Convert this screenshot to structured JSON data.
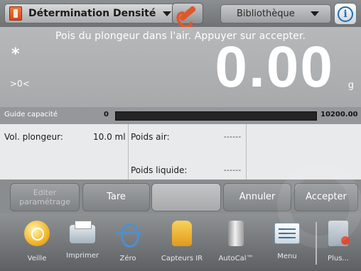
{
  "header": {
    "mode_label": "Détermination Densité",
    "library_label": "Bibliothèque",
    "info_glyph": "i"
  },
  "display": {
    "instruction": "Pois du plongeur dans l'air. Appuyer sur accepter.",
    "stable_indicator": "*",
    "zero_indicator": ">0<",
    "weight": "0.00",
    "unit": "g"
  },
  "capacity": {
    "label": "Guide capacité",
    "min": "0",
    "max": "10200.00",
    "fill_fraction": 0.0
  },
  "panel": {
    "vol_label": "Vol. plongeur:",
    "vol_value": "10.0 ml",
    "air_label": "Poids air:",
    "air_value": "------",
    "liquid_label": "Poids liquide:",
    "liquid_value": "------"
  },
  "actions": {
    "edit_label": "Editer paramétrage",
    "tare_label": "Tare",
    "cancel_label": "Annuler",
    "accept_label": "Accepter"
  },
  "toolbar": {
    "items": [
      {
        "label": "Veille",
        "icon": "power-icon"
      },
      {
        "label": "Imprimer",
        "icon": "printer-icon"
      },
      {
        "label": "Zéro",
        "icon": "zero-icon"
      },
      {
        "label": "Capteurs IR",
        "icon": "hand-icon"
      },
      {
        "label": "AutoCal™",
        "icon": "calibration-weight-icon"
      },
      {
        "label": "Menu",
        "icon": "menu-icon"
      },
      {
        "label": "Plus...",
        "icon": "more-icon"
      }
    ]
  },
  "colors": {
    "accent_blue": "#1f6fb3",
    "mode_icon_orange": "#e0572a"
  }
}
